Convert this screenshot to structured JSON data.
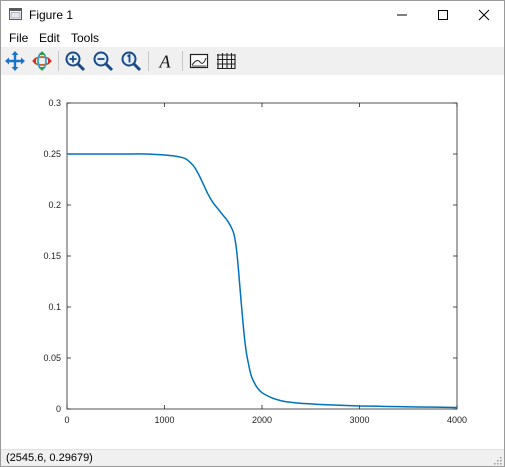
{
  "window": {
    "title": "Figure 1"
  },
  "menu": {
    "file": "File",
    "edit": "Edit",
    "tools": "Tools"
  },
  "toolbar": {
    "buttons": [
      "pan-icon",
      "rotate-icon",
      "zoom-in-icon",
      "zoom-out-icon",
      "zoom-reset-icon",
      "insert-text-icon",
      "toggle-axes-icon",
      "toggle-grid-icon"
    ]
  },
  "status": {
    "coordinates": "(2545.6, 0.29679)"
  },
  "colors": {
    "line": "#0072bd",
    "toolbar_bg": "#f0f0f0",
    "axes": "#262626"
  },
  "chart_data": {
    "type": "line",
    "xlim": [
      0,
      4000
    ],
    "ylim": [
      0,
      0.3
    ],
    "xticks": [
      "0",
      "1000",
      "2000",
      "3000",
      "4000"
    ],
    "yticks": [
      "0",
      "0.05",
      "0.1",
      "0.15",
      "0.2",
      "0.25",
      "0.3"
    ],
    "grid": false,
    "series": [
      {
        "x": [
          0,
          200,
          400,
          600,
          800,
          1000,
          1100,
          1200,
          1250,
          1300,
          1350,
          1400,
          1450,
          1500,
          1550,
          1600,
          1650,
          1700,
          1720,
          1740,
          1760,
          1780,
          1800,
          1820,
          1840,
          1860,
          1880,
          1900,
          1950,
          2000,
          2100,
          2200,
          2300,
          2400,
          2500,
          2700,
          3000,
          3300,
          3600,
          4000
        ],
        "y": [
          0.25,
          0.25,
          0.25,
          0.25,
          0.25,
          0.249,
          0.248,
          0.246,
          0.243,
          0.238,
          0.23,
          0.22,
          0.21,
          0.202,
          0.196,
          0.19,
          0.184,
          0.175,
          0.168,
          0.155,
          0.135,
          0.112,
          0.09,
          0.07,
          0.055,
          0.045,
          0.036,
          0.03,
          0.021,
          0.016,
          0.011,
          0.008,
          0.0065,
          0.0055,
          0.005,
          0.004,
          0.003,
          0.0025,
          0.002,
          0.0015
        ]
      }
    ]
  }
}
